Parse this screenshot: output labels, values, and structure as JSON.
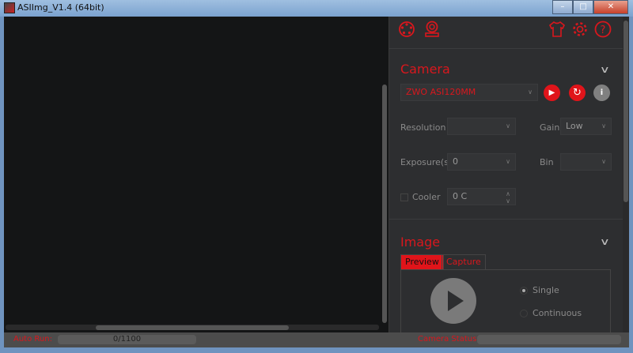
{
  "window": {
    "title": "ASIImg_V1.4 (64bit)"
  },
  "toolbar": {
    "icons": [
      "camera-lens-icon",
      "webcam-icon",
      "shirt-icon",
      "gear-icon",
      "help-icon"
    ]
  },
  "camera": {
    "title": "Camera",
    "device": "ZWO ASI120MM",
    "resolution_label": "Resolution",
    "resolution_value": "",
    "gain_label": "Gain",
    "gain_value": "Low",
    "exposure_label": "Exposure(s)",
    "exposure_value": "0",
    "bin_label": "Bin",
    "bin_value": "",
    "cooler_label": "Cooler",
    "cooler_value": "0 C",
    "cooler_checked": false
  },
  "image": {
    "title": "Image",
    "tabs": [
      {
        "label": "Preview",
        "active": true
      },
      {
        "label": "Capture",
        "active": false
      }
    ],
    "modes": [
      {
        "label": "Single",
        "selected": true
      },
      {
        "label": "Continuous",
        "selected": false
      }
    ]
  },
  "status": {
    "auto_run_label": "Auto Run:",
    "auto_run_value": "0/1100",
    "camera_status_label": "Camera Status:",
    "camera_status_value": ""
  },
  "colors": {
    "accent": "#d9171d",
    "background": "#2d2e30",
    "viewer": "#141516"
  }
}
